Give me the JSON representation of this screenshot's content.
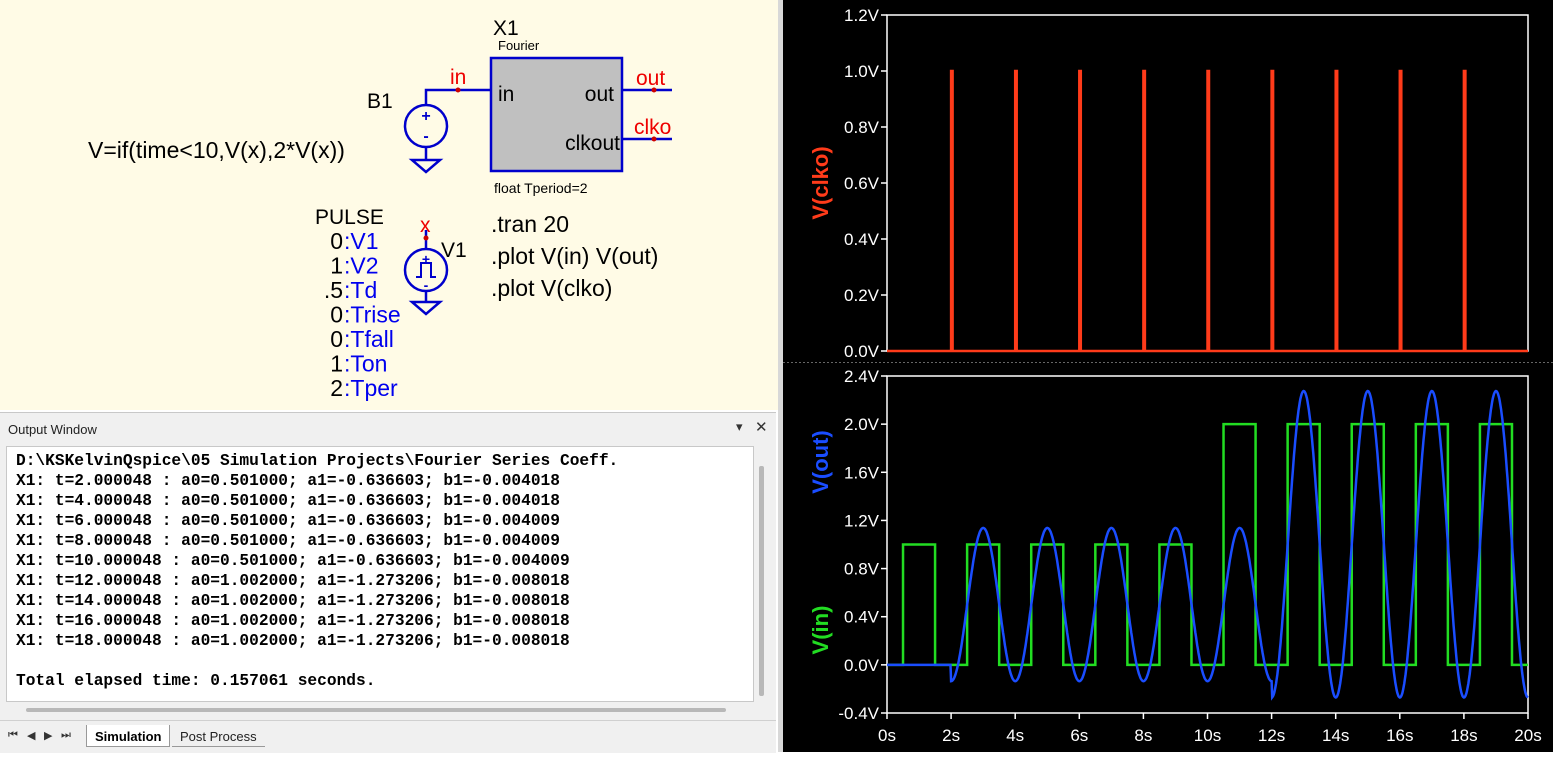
{
  "schematic": {
    "x1": {
      "ref": "X1",
      "type": "Fourier",
      "pin_in": "in",
      "pin_out": "out",
      "pin_clkout": "clkout",
      "param": "float Tperiod=2"
    },
    "b1": {
      "ref": "B1",
      "expr": "V=if(time<10,V(x),2*V(x))"
    },
    "v1": {
      "ref": "V1",
      "kind": "PULSE",
      "params": [
        {
          "value": "0",
          "name": ":V1"
        },
        {
          "value": "1",
          "name": ":V2"
        },
        {
          "value": ".5",
          "name": ":Td"
        },
        {
          "value": "0",
          "name": ":Trise"
        },
        {
          "value": "0",
          "name": ":Tfall"
        },
        {
          "value": "1",
          "name": ":Ton"
        },
        {
          "value": "2",
          "name": ":Tper"
        }
      ]
    },
    "nets": {
      "in": "in",
      "out": "out",
      "clko": "clko",
      "x": "x"
    },
    "directives": [
      ".tran 20",
      ".plot V(in) V(out)",
      ".plot V(clko)"
    ]
  },
  "output_window": {
    "title": "Output Window",
    "pin_icon": "▾",
    "close_icon": "✕",
    "lines": [
      "D:\\KSKelvinQspice\\05 Simulation Projects\\Fourier Series Coeff.",
      "X1: t=2.000048 : a0=0.501000; a1=-0.636603; b1=-0.004018",
      "X1: t=4.000048 : a0=0.501000; a1=-0.636603; b1=-0.004018",
      "X1: t=6.000048 : a0=0.501000; a1=-0.636603; b1=-0.004009",
      "X1: t=8.000048 : a0=0.501000; a1=-0.636603; b1=-0.004009",
      "X1: t=10.000048 : a0=0.501000; a1=-0.636603; b1=-0.004009",
      "X1: t=12.000048 : a0=1.002000; a1=-1.273206; b1=-0.008018",
      "X1: t=14.000048 : a0=1.002000; a1=-1.273206; b1=-0.008018",
      "X1: t=16.000048 : a0=1.002000; a1=-1.273206; b1=-0.008018",
      "X1: t=18.000048 : a0=1.002000; a1=-1.273206; b1=-0.008018",
      "",
      "Total elapsed time: 0.157061 seconds."
    ],
    "tabs": [
      "Simulation",
      "Post Process"
    ],
    "nav": [
      "⏮",
      "◀",
      "▶",
      "⏭"
    ]
  },
  "chart_data": [
    {
      "type": "line",
      "xlim": [
        0,
        20
      ],
      "ylim": [
        0,
        1.2
      ],
      "yticks": [
        "0.0V",
        "0.2V",
        "0.4V",
        "0.6V",
        "0.8V",
        "1.0V",
        "1.2V"
      ],
      "ytick_values": [
        0,
        0.2,
        0.4,
        0.6,
        0.8,
        1.0,
        1.2
      ],
      "series": [
        {
          "name": "V(clko)",
          "color": "#ff3b1a",
          "pulses_at": [
            2,
            4,
            6,
            8,
            10,
            12,
            14,
            16,
            18
          ],
          "pulse_value": 1.0,
          "base_value": 0.0
        }
      ]
    },
    {
      "type": "line",
      "xlim": [
        0,
        20
      ],
      "ylim": [
        -0.4,
        2.4
      ],
      "yticks": [
        "-0.4V",
        "0.0V",
        "0.4V",
        "0.8V",
        "1.2V",
        "1.6V",
        "2.0V",
        "2.4V"
      ],
      "ytick_values": [
        -0.4,
        0,
        0.4,
        0.8,
        1.2,
        1.6,
        2.0,
        2.4
      ],
      "xticks": [
        "0s",
        "2s",
        "4s",
        "6s",
        "8s",
        "10s",
        "12s",
        "14s",
        "16s",
        "18s",
        "20s"
      ],
      "xtick_values": [
        0,
        2,
        4,
        6,
        8,
        10,
        12,
        14,
        16,
        18,
        20
      ],
      "series": [
        {
          "name": "V(out)",
          "color": "#1a4dff",
          "period": 2,
          "segments": [
            {
              "from": 2,
              "to": 12,
              "a0": 0.501,
              "a1": -0.636603,
              "b1": -0.004018
            },
            {
              "from": 12,
              "to": 20,
              "a0": 1.002,
              "a1": -1.273206,
              "b1": -0.008018
            }
          ]
        },
        {
          "name": "V(in)",
          "color": "#22dd22",
          "pulse": {
            "td": 0.5,
            "ton": 1,
            "tper": 2,
            "low": 0,
            "high": 1,
            "double_after": 10
          }
        }
      ]
    }
  ]
}
